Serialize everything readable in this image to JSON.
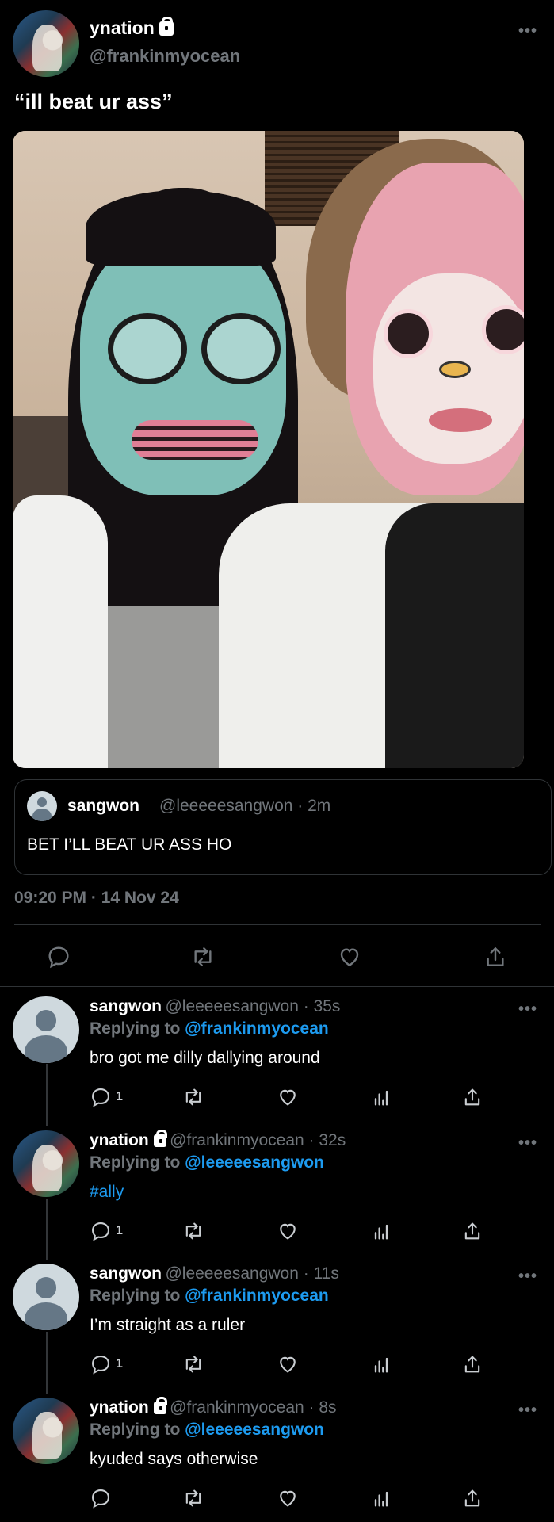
{
  "main_tweet": {
    "display_name": "ynation",
    "handle": "@frankinmyocean",
    "text": "“ill beat ur ass”",
    "more_label": "•••",
    "avatar": "user-photo-avatar",
    "protected_icon": "lock-icon"
  },
  "quoted_tweet": {
    "display_name": "sangwon",
    "meta": "@leeeeesangwon · 2m",
    "text": "BET I’LL BEAT UR ASS HO",
    "avatar": "default-avatar"
  },
  "timestamp": "09:20 PM · 14 Nov 24",
  "actions": [
    "reply-icon",
    "retweet-icon",
    "like-icon",
    "share-icon"
  ],
  "replies": [
    {
      "display_name": "sangwon",
      "meta": "@leeeeesangwon · 35s",
      "replying_prefix": "Replying to ",
      "replying_to": "@frankinmyocean",
      "text": "bro got me dilly dallying around",
      "reply_count": "1",
      "protected": false
    },
    {
      "display_name": "ynation",
      "meta": "@frankinmyocean · 32s",
      "replying_prefix": "Replying to ",
      "replying_to": "@leeeeesangwon",
      "text": "#ally",
      "reply_count": "1",
      "protected": true
    },
    {
      "display_name": "sangwon",
      "meta": "@leeeeesangwon · 11s",
      "replying_prefix": "Replying to ",
      "replying_to": "@frankinmyocean",
      "text": "I’m straight as a ruler",
      "reply_count": "1",
      "protected": false
    },
    {
      "display_name": "ynation",
      "meta": "@frankinmyocean · 8s",
      "replying_prefix": "Replying to ",
      "replying_to": "@leeeeesangwon",
      "text": "kyuded says otherwise",
      "reply_count": "",
      "protected": true
    }
  ],
  "colors": {
    "background": "#000000",
    "text": "#e7e9ea",
    "muted": "#71767b",
    "link": "#1d9bf0",
    "border": "#2f3336"
  }
}
